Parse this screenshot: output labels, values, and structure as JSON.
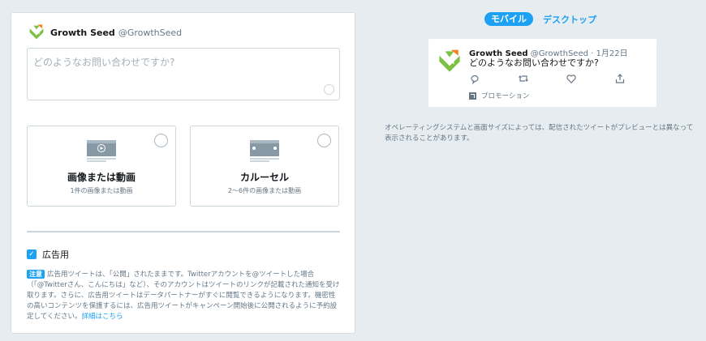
{
  "account": {
    "name": "Growth Seed",
    "handle": "@GrowthSeed"
  },
  "composer": {
    "placeholder": "どのようなお問い合わせですか?",
    "media_options": [
      {
        "title": "画像または動画",
        "subtitle": "1件の画像または動画"
      },
      {
        "title": "カルーセル",
        "subtitle": "2〜6件の画像または動画"
      }
    ],
    "promoted_only": {
      "label": "広告用",
      "checked": true
    },
    "note": {
      "badge": "注意",
      "text": "広告用ツイートは、「公開」されたままです。Twitterアカウントを@ツイートした場合（「@Twitterさん、こんにちは」など）、そのアカウントはツイートのリンクが記載された通知を受け取ります。さらに、広告用ツイートはデータパートナーがすぐに閲覧できるようになります。機密性の高いコンテンツを保護するには、広告用ツイートがキャンペーン開始後に公開されるように予約設定してください。",
      "link": "詳細はこちら"
    }
  },
  "preview": {
    "tabs": {
      "mobile": "モバイル",
      "desktop": "デスクトップ"
    },
    "name": "Growth Seed",
    "handle": "@GrowthSeed",
    "date": "· 1月22日",
    "text": "どのようなお問い合わせですか?",
    "promoted": "プロモーション",
    "disclaimer": "オペレーティングシステムと画面サイズによっては、配信されたツイートがプレビューとは異なって表示されることがあります。"
  },
  "colors": {
    "accent": "#1da1f2",
    "logo_green": "#7bc143",
    "logo_orange": "#f58220"
  }
}
